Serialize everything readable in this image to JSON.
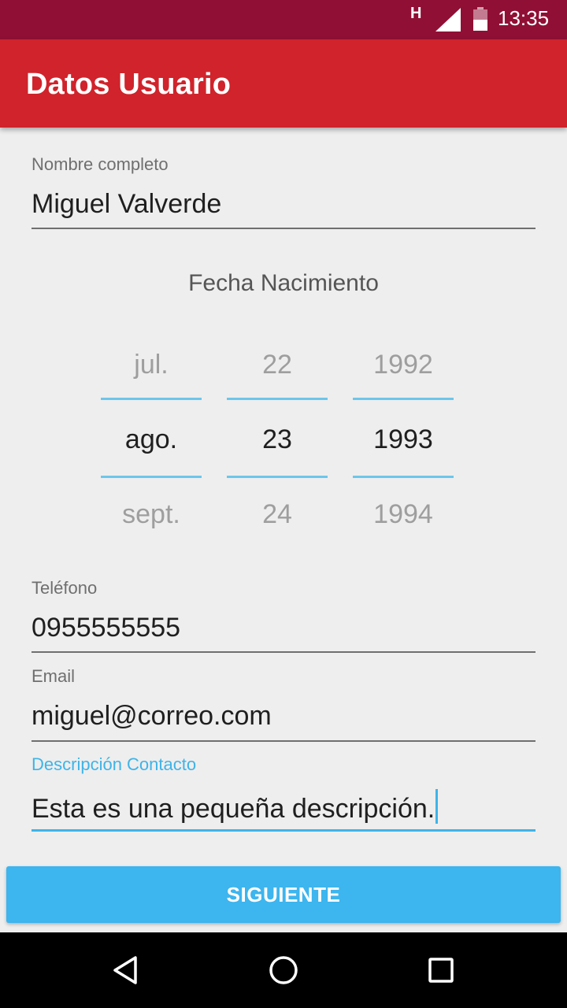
{
  "status_bar": {
    "network_type": "H",
    "time": "13:35",
    "icons": [
      "signal-icon",
      "battery-icon"
    ]
  },
  "app_bar": {
    "title": "Datos Usuario",
    "color": "#d0232b"
  },
  "form": {
    "nombre": {
      "label": "Nombre completo",
      "value": "Miguel Valverde"
    },
    "fecha": {
      "title": "Fecha Nacimiento",
      "month": {
        "prev": "jul.",
        "selected": "ago.",
        "next": "sept."
      },
      "day": {
        "prev": "22",
        "selected": "23",
        "next": "24"
      },
      "year": {
        "prev": "1992",
        "selected": "1993",
        "next": "1994"
      }
    },
    "telefono": {
      "label": "Teléfono",
      "value": "0955555555"
    },
    "email": {
      "label": "Email",
      "value": "miguel@correo.com"
    },
    "descripcion": {
      "label": "Descripción Contacto",
      "value": "Esta es una pequeña descripción.",
      "focused": true
    }
  },
  "actions": {
    "next_label": "SIGUIENTE",
    "color": "#3db5ee"
  },
  "nav_bar": {
    "icons": [
      "back-icon",
      "home-icon",
      "recents-icon"
    ]
  },
  "colors": {
    "status_bar": "#900f35",
    "accent": "#3eb4e8"
  }
}
